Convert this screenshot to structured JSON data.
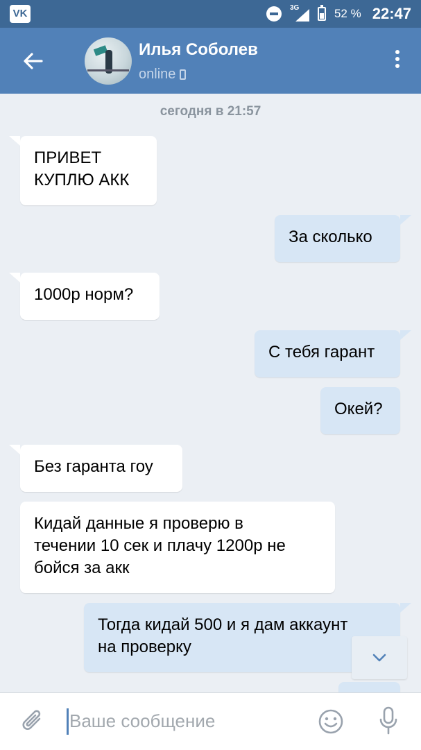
{
  "status_bar": {
    "app_icon": "vk-logo",
    "app_label": "VK",
    "network": "3G",
    "battery_percent": "52 %",
    "time": "22:47"
  },
  "header": {
    "name": "Илья Соболев",
    "status": "online"
  },
  "chat": {
    "date_label": "сегодня в 21:57",
    "messages": [
      {
        "direction": "in",
        "text": "ПРИВЕТ\nКУПЛЮ АКК"
      },
      {
        "direction": "out",
        "text": "За сколько"
      },
      {
        "direction": "in",
        "text": "1000р норм?"
      },
      {
        "direction": "out",
        "text": "С тебя гарант"
      },
      {
        "direction": "out",
        "text": "Окей?"
      },
      {
        "direction": "in",
        "text": "Без гаранта гоу"
      },
      {
        "direction": "in",
        "text": "Кидай данные я проверю в\nтечении 10 сек и плачу 1200р не\nбойся за акк"
      },
      {
        "direction": "out",
        "text": "Тогда кидай 500 и я дам аккаунт\nна проверку"
      },
      {
        "direction": "out",
        "text": ""
      }
    ]
  },
  "composer": {
    "placeholder": "Ваше сообщение"
  },
  "colors": {
    "status_bar": "#3d6895",
    "header": "#5181b8",
    "background": "#ebeff4",
    "incoming_bubble": "#ffffff",
    "outgoing_bubble": "#d7e6f5"
  }
}
